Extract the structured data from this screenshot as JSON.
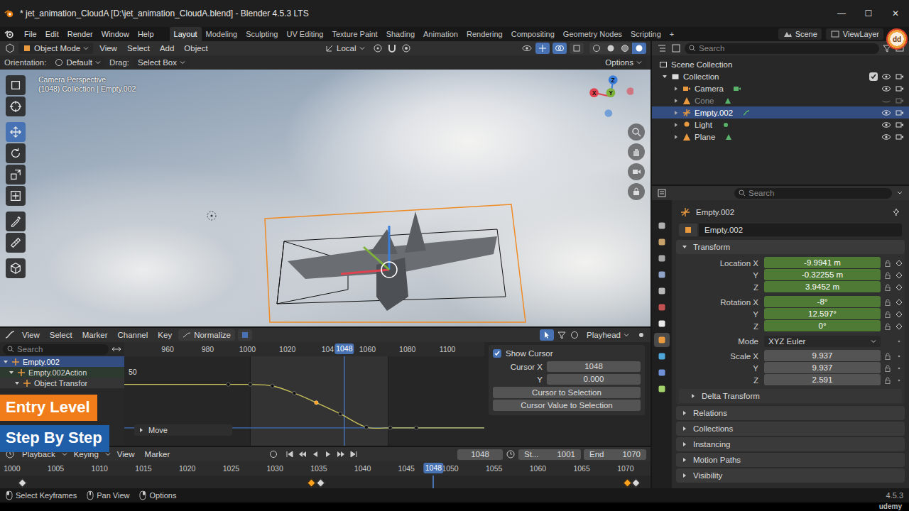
{
  "window": {
    "title": "* jet_animation_CloudA [D:\\jet_animation_CloudA.blend] - Blender 4.5.3 LTS",
    "controls": [
      "—",
      "☐",
      "✕"
    ]
  },
  "menu": [
    "File",
    "Edit",
    "Render",
    "Window",
    "Help"
  ],
  "workspaces": [
    {
      "label": "Layout",
      "selected": true
    },
    {
      "label": "Modeling",
      "selected": false
    },
    {
      "label": "Sculpting",
      "selected": false
    },
    {
      "label": "UV Editing",
      "selected": false
    },
    {
      "label": "Texture Paint",
      "selected": false
    },
    {
      "label": "Shading",
      "selected": false
    },
    {
      "label": "Animation",
      "selected": false
    },
    {
      "label": "Rendering",
      "selected": false
    },
    {
      "label": "Compositing",
      "selected": false
    },
    {
      "label": "Geometry Nodes",
      "selected": false
    },
    {
      "label": "Scripting",
      "selected": false
    }
  ],
  "workspace_add": "+",
  "scene": "Scene",
  "view_layer": "ViewLayer",
  "logo": "dd",
  "viewport": {
    "mode": "Object Mode",
    "menus": [
      "View",
      "Select",
      "Add",
      "Object"
    ],
    "transform_orientation": "Local",
    "orientation_label": "Orientation:",
    "orientation": "Default",
    "drag_label": "Drag:",
    "drag": "Select Box",
    "options": "Options",
    "overlay_lines": [
      "Camera Perspective",
      "(1048) Collection | Empty.002"
    ],
    "gizmo_axes": [
      {
        "label": "X",
        "color": "#e0434f"
      },
      {
        "label": "Y",
        "color": "#7fb23a"
      },
      {
        "label": "Z",
        "color": "#3b7ed9"
      }
    ],
    "tools": [
      {
        "kind": "select",
        "selected": false
      },
      {
        "kind": "cursor",
        "selected": false
      },
      {
        "kind": "move",
        "selected": true
      },
      {
        "kind": "rotate",
        "selected": false
      },
      {
        "kind": "scale",
        "selected": false
      },
      {
        "kind": "transform",
        "selected": false
      },
      {
        "kind": "annotate",
        "selected": false
      },
      {
        "kind": "measure",
        "selected": false
      },
      {
        "kind": "add-cube",
        "selected": false
      }
    ]
  },
  "graph_editor": {
    "menus": [
      "View",
      "Select",
      "Marker",
      "Channel",
      "Key"
    ],
    "normalize": {
      "label": "Normalize",
      "on": false
    },
    "playhead": "Playhead",
    "search_placeholder": "Search",
    "channels": [
      {
        "label": "Empty.002",
        "depth": 0,
        "selected": true
      },
      {
        "label": "Empty.002Action",
        "depth": 1,
        "selected": false
      },
      {
        "label": "Object Transfor",
        "depth": 2,
        "selected": false
      }
    ],
    "ruler": [
      "960",
      "980",
      "1000",
      "1020",
      "104",
      "1060",
      "1080",
      "1100"
    ],
    "current_frame": "1048",
    "value_label": "50",
    "operator": "Move",
    "keys": [
      {
        "frame": 990,
        "value": 38.8,
        "selected": false
      },
      {
        "frame": 1001,
        "value": 38.8,
        "selected": false
      },
      {
        "frame": 1012,
        "value": 37.5,
        "selected": false
      },
      {
        "frame": 1023,
        "value": 31,
        "selected": false
      },
      {
        "frame": 1034,
        "value": 22.5,
        "selected": true
      },
      {
        "frame": 1046,
        "value": 12.5,
        "selected": false
      },
      {
        "frame": 1059,
        "value": 0.6,
        "selected": false
      },
      {
        "frame": 1071,
        "value": 0,
        "selected": false
      },
      {
        "frame": 1084,
        "value": 0,
        "selected": false
      }
    ],
    "sidebar": {
      "show_cursor": {
        "label": "Show Cursor",
        "checked": true
      },
      "fields": [
        {
          "label": "Cursor X",
          "value": "1048"
        },
        {
          "label": "Y",
          "value": "0.000"
        }
      ],
      "buttons": [
        "Cursor to Selection",
        "Cursor Value to Selection"
      ]
    }
  },
  "timeline": {
    "menus": [
      "Playback",
      "Keying",
      "View",
      "Marker"
    ],
    "current": "1048",
    "start_label": "St...",
    "start": "1001",
    "end_label": "End",
    "end": "1070",
    "ruler": [
      "1000",
      "1005",
      "1010",
      "1015",
      "1020",
      "1025",
      "1030",
      "1035",
      "1040",
      "1045",
      "1050",
      "1055",
      "1060",
      "1065",
      "1070"
    ],
    "keys": [
      {
        "frame": 1001,
        "selected": false
      },
      {
        "frame": 1034,
        "selected": true
      },
      {
        "frame": 1035,
        "selected": false
      },
      {
        "frame": 1070,
        "selected": true
      },
      {
        "frame": 1071,
        "selected": false
      }
    ]
  },
  "outliner": {
    "search_placeholder": "Search",
    "root": "Scene Collection",
    "collection": {
      "label": "Collection",
      "checked": true
    },
    "items": [
      {
        "label": "Camera",
        "kind": "camera",
        "selected": false,
        "visible": true
      },
      {
        "label": "Cone",
        "kind": "mesh",
        "selected": false,
        "visible": false
      },
      {
        "label": "Empty.002",
        "kind": "empty",
        "selected": true,
        "visible": true
      },
      {
        "label": "Light",
        "kind": "light",
        "selected": false,
        "visible": true
      },
      {
        "label": "Plane",
        "kind": "mesh",
        "selected": false,
        "visible": true
      }
    ]
  },
  "properties": {
    "search_placeholder": "Search",
    "object_name": "Empty.002",
    "datablock": "Empty.002",
    "tabs": [
      {
        "kind": "tool",
        "selected": false
      },
      {
        "kind": "render",
        "selected": false
      },
      {
        "kind": "output",
        "selected": false
      },
      {
        "kind": "view-layer",
        "selected": false
      },
      {
        "kind": "scene",
        "selected": false
      },
      {
        "kind": "world",
        "selected": false
      },
      {
        "kind": "collection",
        "selected": false
      },
      {
        "kind": "object",
        "selected": true
      },
      {
        "kind": "physics",
        "selected": false
      },
      {
        "kind": "constraints",
        "selected": false
      },
      {
        "kind": "data",
        "selected": false
      }
    ],
    "transform": {
      "title": "Transform",
      "expanded": true,
      "groups": [
        {
          "rows": [
            {
              "label": "Location X",
              "value": "-9.9941 m",
              "kind": "field",
              "animated": true
            },
            {
              "label": "Y",
              "value": "-0.32255 m",
              "kind": "field",
              "animated": true
            },
            {
              "label": "Z",
              "value": "3.9452 m",
              "kind": "field",
              "animated": true
            }
          ]
        },
        {
          "rows": [
            {
              "label": "Rotation X",
              "value": "-8°",
              "kind": "field",
              "animated": true
            },
            {
              "label": "Y",
              "value": "12.597°",
              "kind": "field",
              "animated": true
            },
            {
              "label": "Z",
              "value": "0°",
              "kind": "field",
              "animated": true
            }
          ]
        },
        {
          "rows": [
            {
              "label": "Mode",
              "value": "XYZ Euler",
              "kind": "dropdown",
              "animated": false
            }
          ]
        },
        {
          "rows": [
            {
              "label": "Scale X",
              "value": "9.937",
              "kind": "field",
              "animated": false
            },
            {
              "label": "Y",
              "value": "9.937",
              "kind": "field",
              "animated": false
            },
            {
              "label": "Z",
              "value": "2.591",
              "kind": "field",
              "animated": false
            }
          ]
        }
      ],
      "subpanel": {
        "title": "Delta Transform",
        "expanded": false
      }
    },
    "panels": [
      {
        "title": "Relations",
        "expanded": false
      },
      {
        "title": "Collections",
        "expanded": false
      },
      {
        "title": "Instancing",
        "expanded": false
      },
      {
        "title": "Motion Paths",
        "expanded": false
      },
      {
        "title": "Visibility",
        "expanded": false
      }
    ]
  },
  "status_bar": {
    "hints": [
      "Select Keyframes",
      "Pan View",
      "Options"
    ],
    "version": "4.5.3"
  },
  "badges": [
    {
      "label": "Entry Level",
      "color": "#f07d1a"
    },
    {
      "label": "Step By Step",
      "color": "#1f5ea8"
    }
  ],
  "brand": "udemy"
}
